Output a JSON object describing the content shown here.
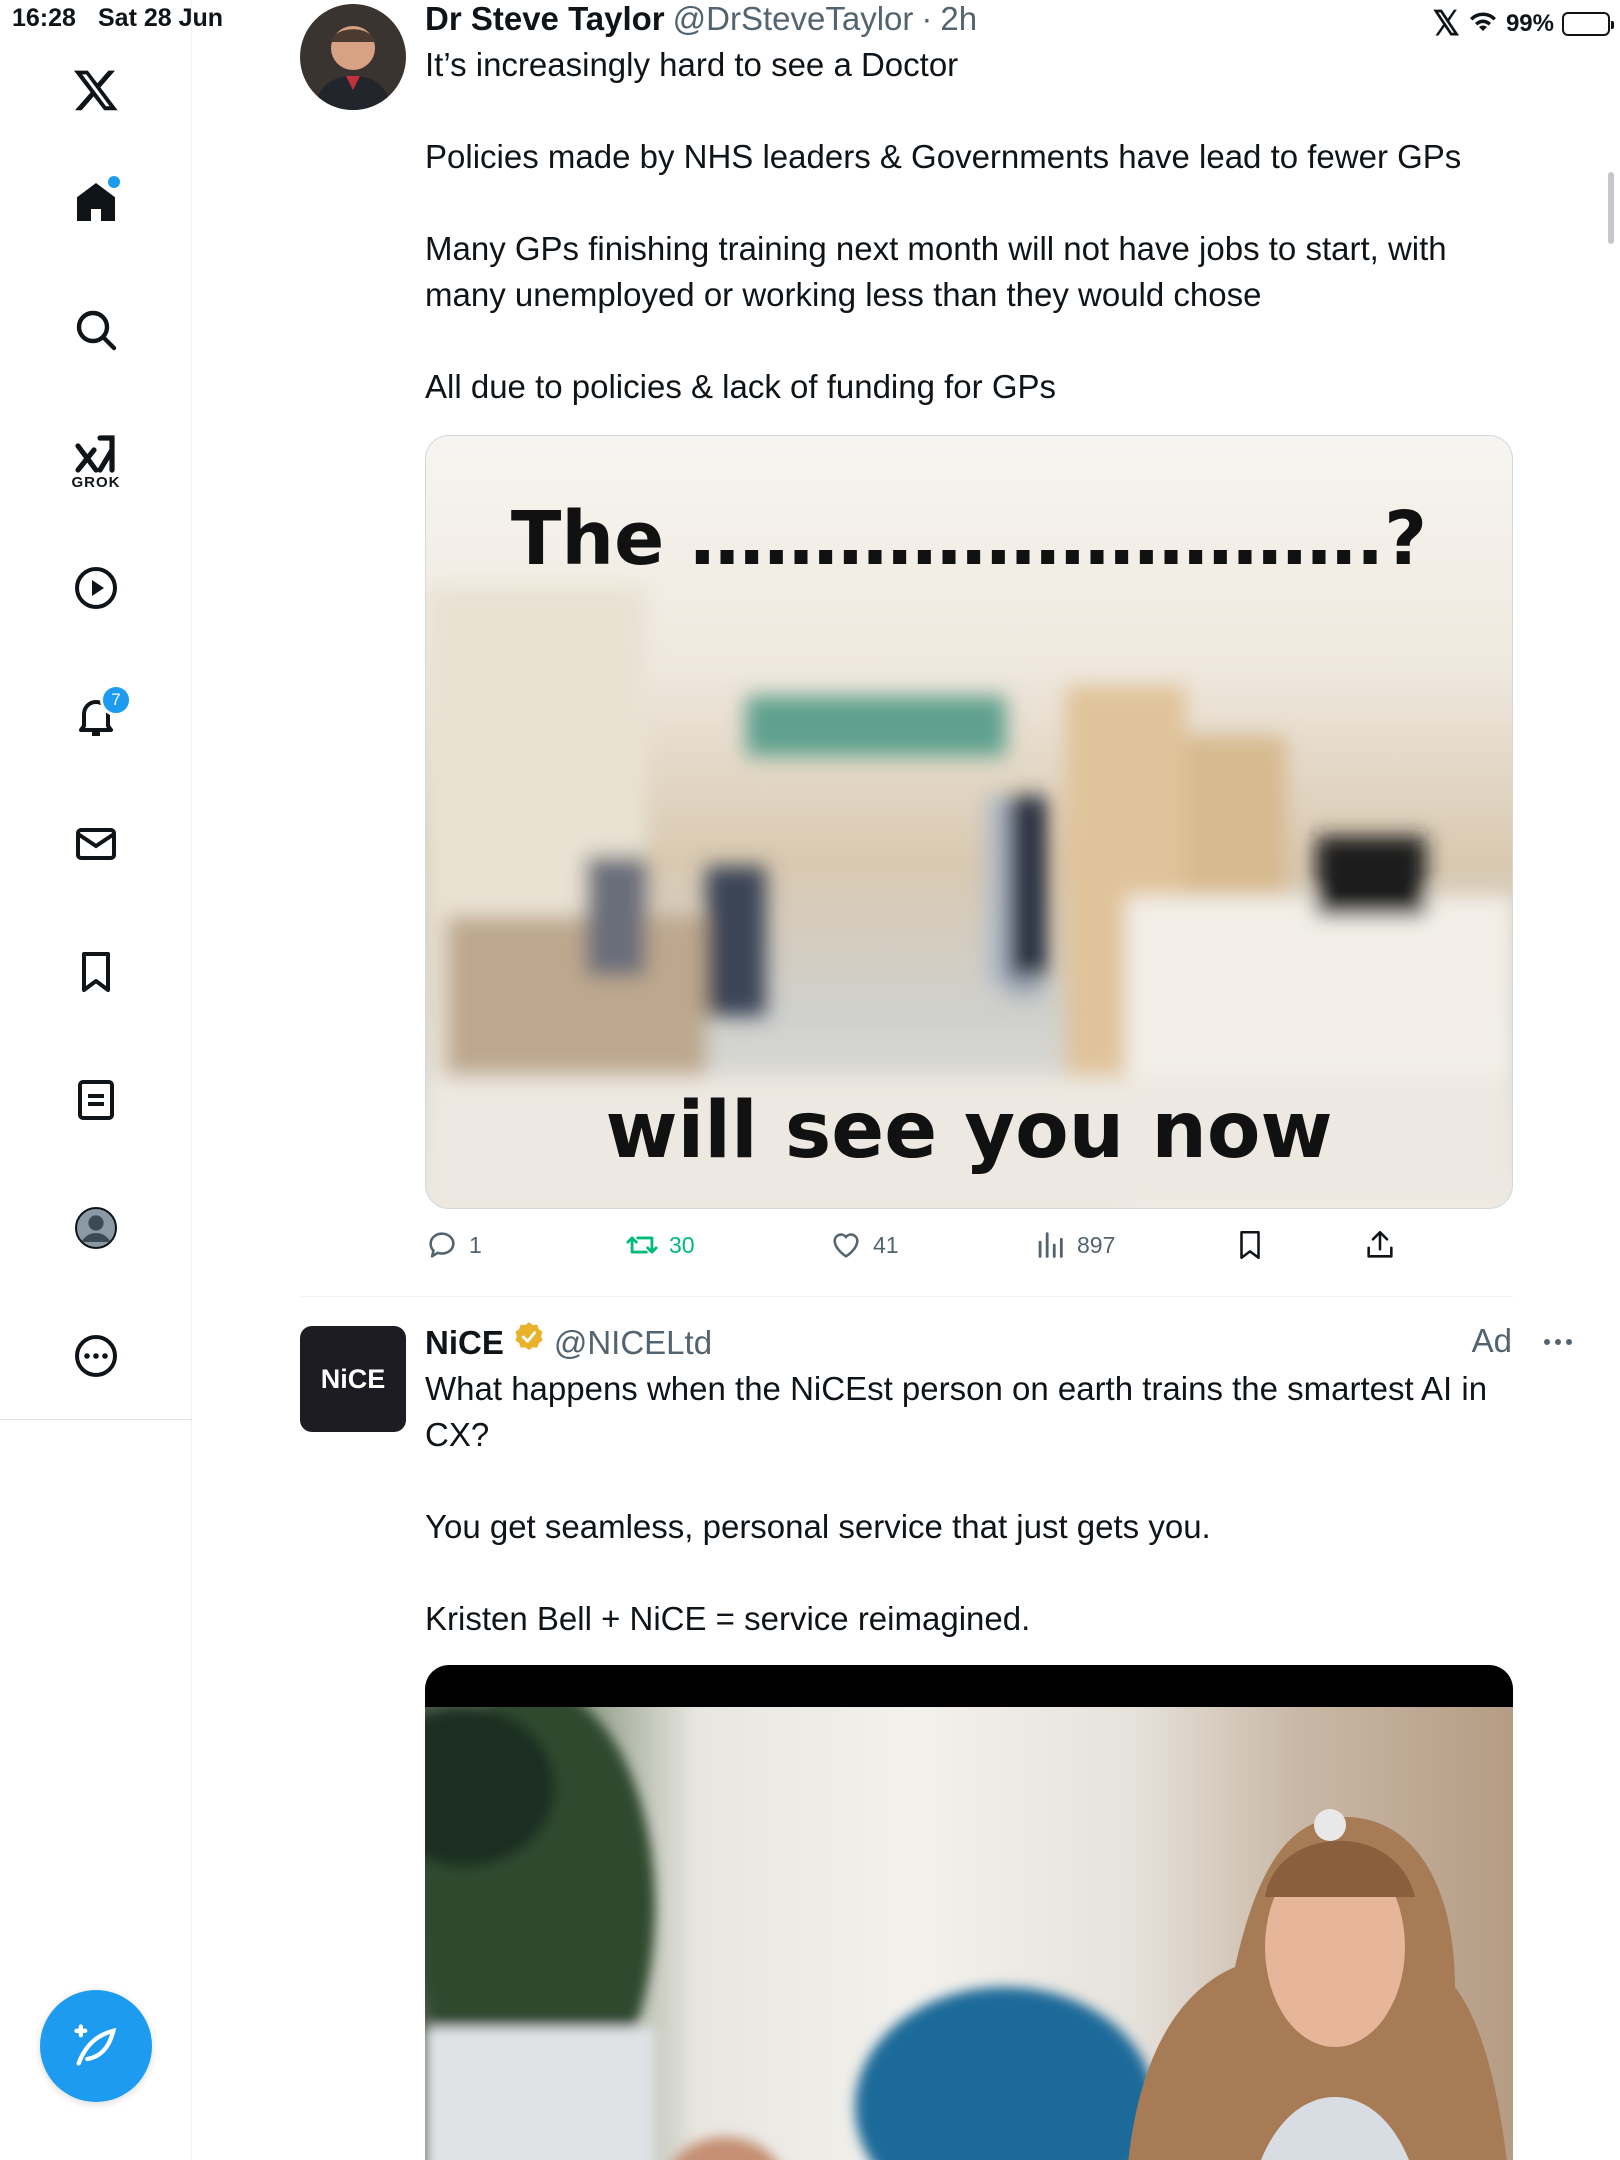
{
  "status_bar": {
    "time": "16:28",
    "date": "Sat 28 Jun",
    "battery": "99%"
  },
  "sidebar": {
    "grok_label": "GROK",
    "notifications_count": "7",
    "items": [
      "x-logo",
      "home",
      "search",
      "grok",
      "video",
      "notifications",
      "messages",
      "bookmarks",
      "lists",
      "profile",
      "more"
    ]
  },
  "tweet1": {
    "name": "Dr Steve Taylor",
    "handle": "@DrSteveTaylor",
    "separator": "·",
    "time": "2h",
    "text": "It’s increasingly hard to see a Doctor\n\nPolicies made by NHS leaders & Governments have lead to fewer GPs\n\nMany GPs finishing training next month will not have jobs to start, with many unemployed or working less than they would chose\n\nAll due to policies & lack of funding for GPs",
    "image_caption_top": "The ……………………….?",
    "image_caption_bottom": "will see you now",
    "replies": "1",
    "reposts": "30",
    "likes": "41",
    "views": "897"
  },
  "tweet2": {
    "logo_text": "NiCE",
    "name": "NiCE",
    "handle": "@NICELtd",
    "ad_label": "Ad",
    "text": "What happens when the NiCEst person on earth trains the smartest AI in CX?\n\nYou get seamless, personal service that just gets you.\n\nKristen Bell + NiCE = service reimagined."
  },
  "colors": {
    "accent": "#1d9bf0",
    "repost": "#00ba7c",
    "muted": "#536471",
    "text": "#0f1419"
  }
}
